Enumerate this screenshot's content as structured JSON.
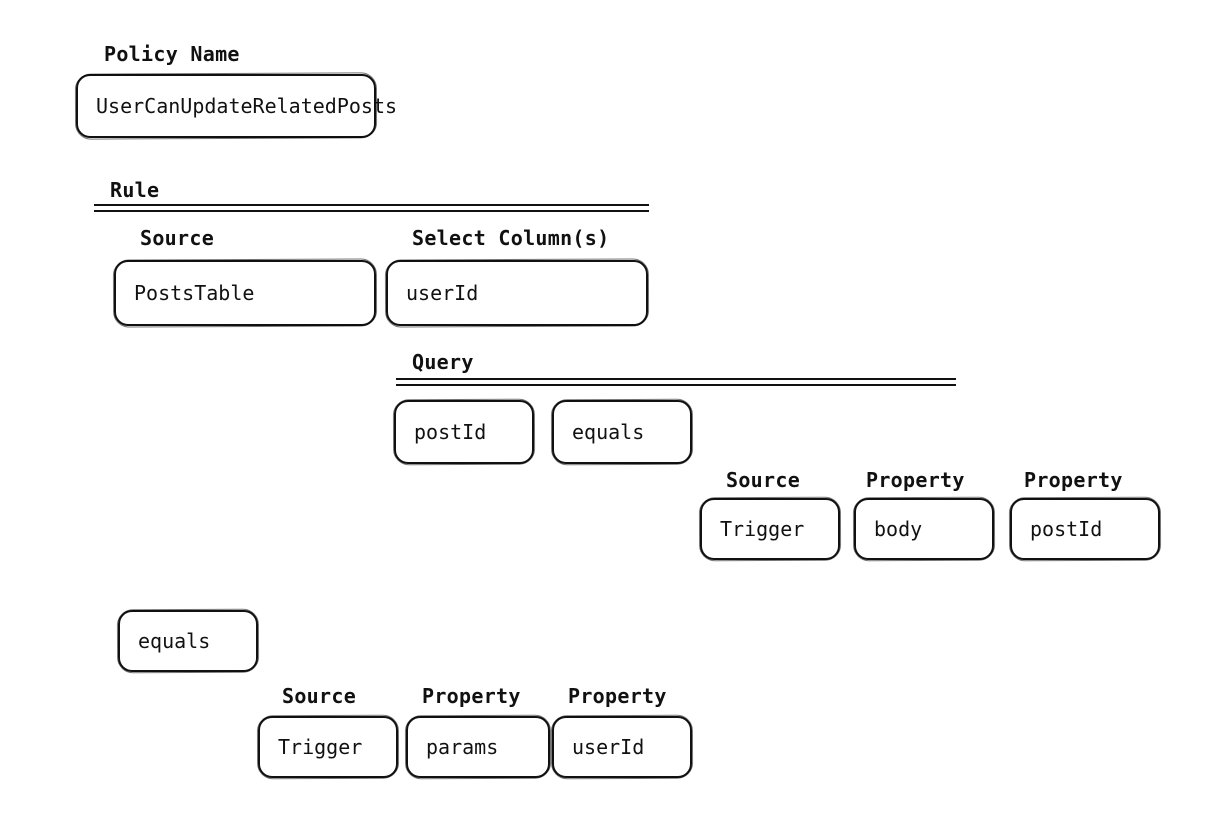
{
  "policy": {
    "label": "Policy Name",
    "value": "UserCanUpdateRelatedPosts"
  },
  "rule": {
    "label": "Rule",
    "source": {
      "label": "Source",
      "value": "PostsTable"
    },
    "select": {
      "label": "Select Column(s)",
      "value": "userId"
    },
    "query": {
      "label": "Query",
      "column": "postId",
      "operator": "equals",
      "rhs": {
        "source": {
          "label": "Source",
          "value": "Trigger"
        },
        "property1": {
          "label": "Property",
          "value": "body"
        },
        "property2": {
          "label": "Property",
          "value": "postId"
        }
      }
    }
  },
  "compare": {
    "operator": "equals",
    "rhs": {
      "source": {
        "label": "Source",
        "value": "Trigger"
      },
      "property1": {
        "label": "Property",
        "value": "params"
      },
      "property2": {
        "label": "Property",
        "value": "userId"
      }
    }
  }
}
